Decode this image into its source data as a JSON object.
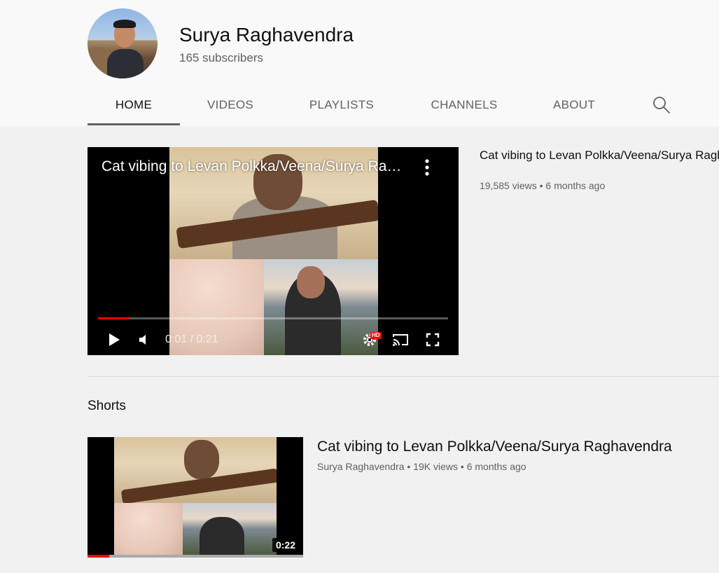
{
  "channel": {
    "name": "Surya Raghavendra",
    "subscribers": "165 subscribers",
    "avatar_icon": "avatar-photo"
  },
  "tabs": [
    {
      "label": "HOME",
      "active": true
    },
    {
      "label": "VIDEOS",
      "active": false
    },
    {
      "label": "PLAYLISTS",
      "active": false
    },
    {
      "label": "CHANNELS",
      "active": false
    },
    {
      "label": "ABOUT",
      "active": false
    }
  ],
  "search_icon": "search-icon",
  "featured": {
    "player_title": "Cat vibing to Levan Polkka/Veena/Surya Raghavendra",
    "time": "0:01 / 0:21",
    "progress": 0.09,
    "hd_badge": "HD",
    "title": "Cat vibing to Levan Polkka/Veena/Surya Raghavendra",
    "views": "19,585 views",
    "age": "6 months ago"
  },
  "shorts": {
    "section_title": "Shorts",
    "item": {
      "title": "Cat vibing to Levan Polkka/Veena/Surya Raghavendra",
      "channel": "Surya Raghavendra",
      "views": "19K views",
      "age": "6 months ago",
      "duration": "0:22",
      "watched": 0.1
    }
  },
  "colors": {
    "accent_red": "#ff0000",
    "text_primary": "#0f0f0f",
    "text_secondary": "#606060",
    "page_bg": "#f1f1f1",
    "header_bg": "#f9f9f9"
  },
  "separator": "•"
}
